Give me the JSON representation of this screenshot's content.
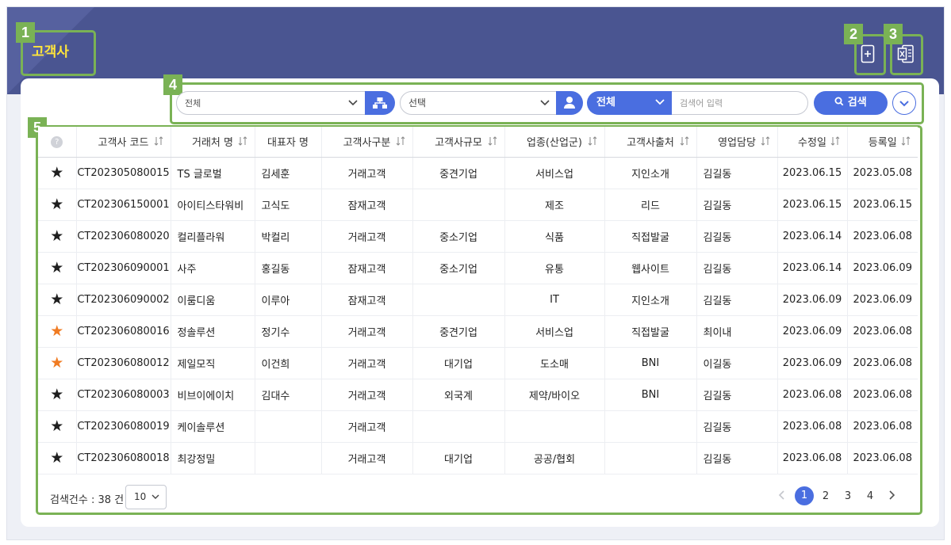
{
  "header": {
    "title": "고객사"
  },
  "callouts": [
    "1",
    "2",
    "3",
    "4",
    "5"
  ],
  "search": {
    "select1": "전체",
    "select2": "선택",
    "scope": "전체",
    "keyword_placeholder": "검색어 입력",
    "search_label": "검색"
  },
  "table": {
    "columns": [
      "고객사 코드",
      "거래처 명",
      "대표자 명",
      "고객사구분",
      "고객사규모",
      "업종(산업군)",
      "고객사출처",
      "영업담당",
      "수정일",
      "등록일"
    ],
    "rows": [
      {
        "fav": "★",
        "star_color": "#1f1f1f",
        "code": "CT202305080015",
        "name": "TS 글로벌",
        "ceo": "김세훈",
        "type": "거래고객",
        "size": "중견기업",
        "industry": "서비스업",
        "source": "지인소개",
        "rep": "김길동",
        "modified": "2023.06.15",
        "registered": "2023.05.08"
      },
      {
        "fav": "★",
        "star_color": "#1f1f1f",
        "code": "CT202306150001",
        "name": "아이티스타워비",
        "ceo": "고식도",
        "type": "잠재고객",
        "size": "",
        "industry": "제조",
        "source": "리드",
        "rep": "김길동",
        "modified": "2023.06.15",
        "registered": "2023.06.15"
      },
      {
        "fav": "★",
        "star_color": "#1f1f1f",
        "code": "CT202306080020",
        "name": "컬리플라워",
        "ceo": "박컬리",
        "type": "거래고객",
        "size": "중소기업",
        "industry": "식품",
        "source": "직접발굴",
        "rep": "김길동",
        "modified": "2023.06.14",
        "registered": "2023.06.08"
      },
      {
        "fav": "★",
        "star_color": "#1f1f1f",
        "code": "CT202306090001",
        "name": "사주",
        "ceo": "홍길동",
        "type": "잠재고객",
        "size": "중소기업",
        "industry": "유통",
        "source": "웹사이트",
        "rep": "김길동",
        "modified": "2023.06.14",
        "registered": "2023.06.09"
      },
      {
        "fav": "★",
        "star_color": "#1f1f1f",
        "code": "CT202306090002",
        "name": "이룸디움",
        "ceo": "이루아",
        "type": "잠재고객",
        "size": "",
        "industry": "IT",
        "source": "지인소개",
        "rep": "김길동",
        "modified": "2023.06.09",
        "registered": "2023.06.09"
      },
      {
        "fav": "★",
        "star_color": "#f07b22",
        "code": "CT202306080016",
        "name": "정솔루션",
        "ceo": "정기수",
        "type": "거래고객",
        "size": "중견기업",
        "industry": "서비스업",
        "source": "직접발굴",
        "rep": "최이내",
        "modified": "2023.06.09",
        "registered": "2023.06.08"
      },
      {
        "fav": "★",
        "star_color": "#f07b22",
        "code": "CT202306080012",
        "name": "제일모직",
        "ceo": "이건희",
        "type": "거래고객",
        "size": "대기업",
        "industry": "도소매",
        "source": "BNI",
        "rep": "이길동",
        "modified": "2023.06.09",
        "registered": "2023.06.08"
      },
      {
        "fav": "★",
        "star_color": "#1f1f1f",
        "code": "CT202306080003",
        "name": "비브이에이치",
        "ceo": "김대수",
        "type": "거래고객",
        "size": "외국계",
        "industry": "제약/바이오",
        "source": "BNI",
        "rep": "김길동",
        "modified": "2023.06.08",
        "registered": "2023.06.08"
      },
      {
        "fav": "★",
        "star_color": "#1f1f1f",
        "code": "CT202306080019",
        "name": "케이솔루션",
        "ceo": "",
        "type": "거래고객",
        "size": "",
        "industry": "",
        "source": "",
        "rep": "김길동",
        "modified": "2023.06.08",
        "registered": "2023.06.08"
      },
      {
        "fav": "★",
        "star_color": "#1f1f1f",
        "code": "CT202306080018",
        "name": "최강정밀",
        "ceo": "",
        "type": "거래고객",
        "size": "대기업",
        "industry": "공공/협회",
        "source": "",
        "rep": "김길동",
        "modified": "2023.06.08",
        "registered": "2023.06.08"
      }
    ]
  },
  "footer": {
    "count_text": "검색건수 : 38 건",
    "page_size": "10",
    "pages": [
      "1",
      "2",
      "3",
      "4"
    ],
    "current_page": "1"
  },
  "colors": {
    "banner": "#4a5591",
    "accent": "#4a6ee0",
    "callout": "#7ab255",
    "title": "#ffe53b"
  }
}
